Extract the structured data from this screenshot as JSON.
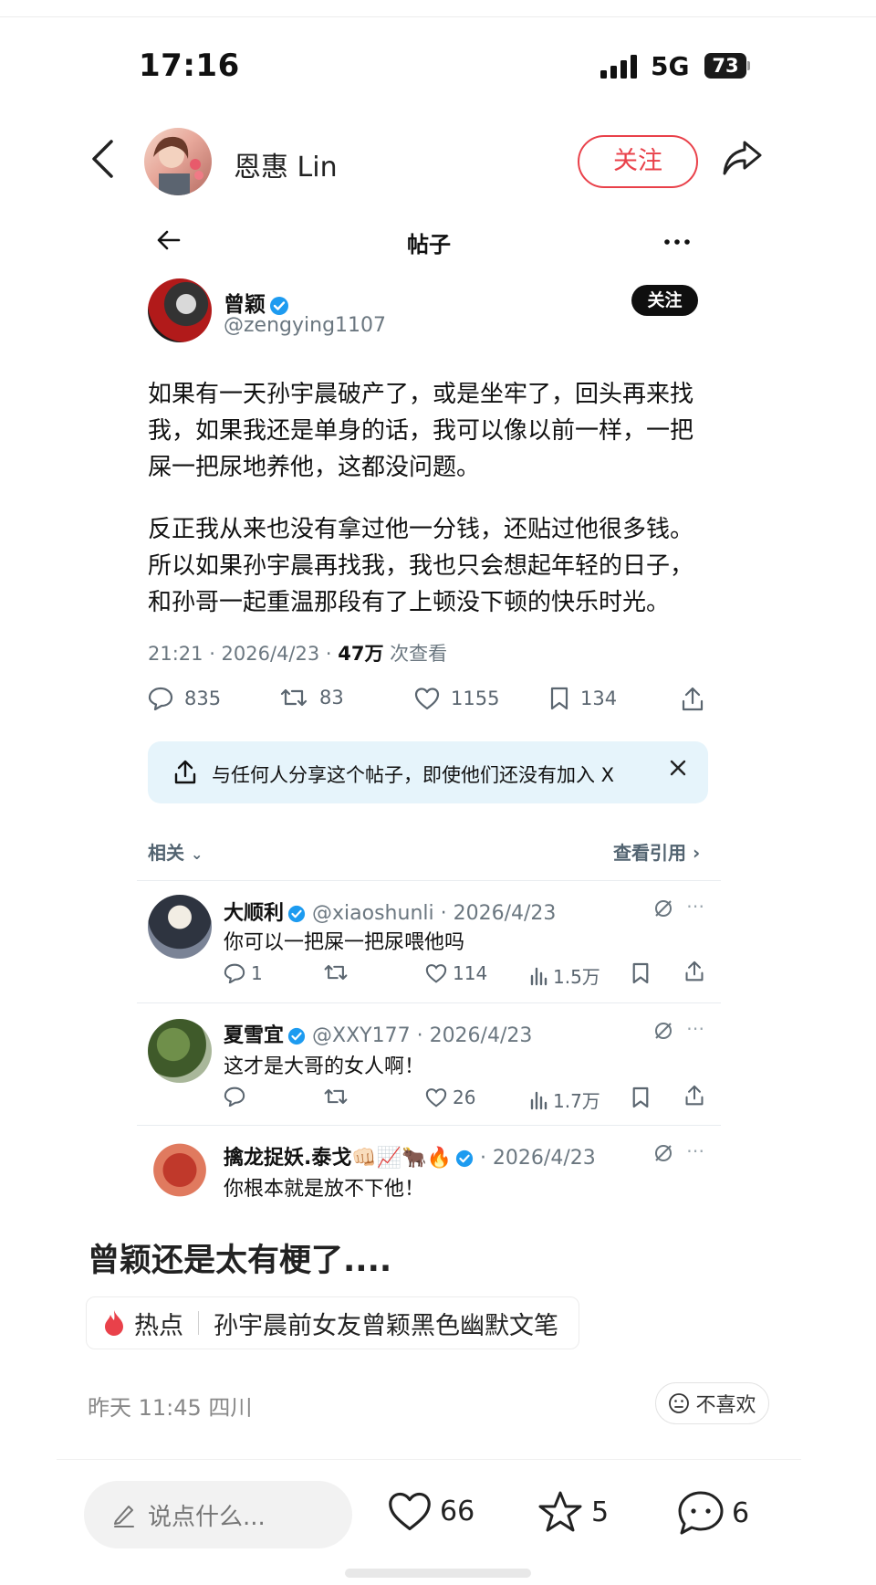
{
  "status_bar": {
    "time": "17:16",
    "network": "5G",
    "battery": "73"
  },
  "header": {
    "username": "恩惠 Lin",
    "follow_label": "关注"
  },
  "tweet": {
    "page_title": "帖子",
    "author_name": "曾颖",
    "author_handle": "@zengying1107",
    "follow_label": "关注",
    "paragraphs": [
      "如果有一天孙宇晨破产了，或是坐牢了，回头再来找我，如果我还是单身的话，我可以像以前一样，一把屎一把尿地养他，这都没问题。",
      "反正我从来也没有拿过他一分钱，还贴过他很多钱。所以如果孙宇晨再找我，我也只会想起年轻的日子，和孙哥一起重温那段有了上顿没下顿的快乐时光。"
    ],
    "timestamp": "21:21 · 2026/4/23 · ",
    "views": "47万",
    "views_suffix": " 次查看",
    "stats": {
      "replies": "835",
      "reposts": "83",
      "likes": "1155",
      "bookmarks": "134"
    },
    "share_banner": "与任何人分享这个帖子，即使他们还没有加入 X",
    "related_label": "相关",
    "quotes_label": "查看引用"
  },
  "replies": [
    {
      "name": "大顺利",
      "handle": "@xiaoshunli · 2026/4/23",
      "text": "你可以一把屎一把尿喂他吗",
      "replies": "1",
      "reposts": "",
      "likes": "114",
      "views": "1.5万"
    },
    {
      "name": "夏雪宜",
      "handle": "@XXY177 · 2026/4/23",
      "text": "这才是大哥的女人啊！",
      "replies": "",
      "reposts": "",
      "likes": "26",
      "views": "1.7万"
    },
    {
      "name": "擒龙捉妖.泰戈👊🏻📈🐂🔥",
      "handle": "· 2026/4/23",
      "text": "你根本就是放不下他！"
    }
  ],
  "post": {
    "caption": "曾颖还是太有梗了....",
    "hot_label": "热点",
    "hot_topic": "孙宇晨前女友曾颖黑色幽默文笔",
    "time_location": "昨天 11:45 四川",
    "dislike_label": "不喜欢"
  },
  "bottom_bar": {
    "comment_placeholder": "说点什么...",
    "likes": "66",
    "favorites": "5",
    "comments": "6"
  },
  "colors": {
    "brand_red": "#e9414a",
    "verified_blue": "#1d9bf0",
    "banner_bg": "#e6f4fb"
  }
}
